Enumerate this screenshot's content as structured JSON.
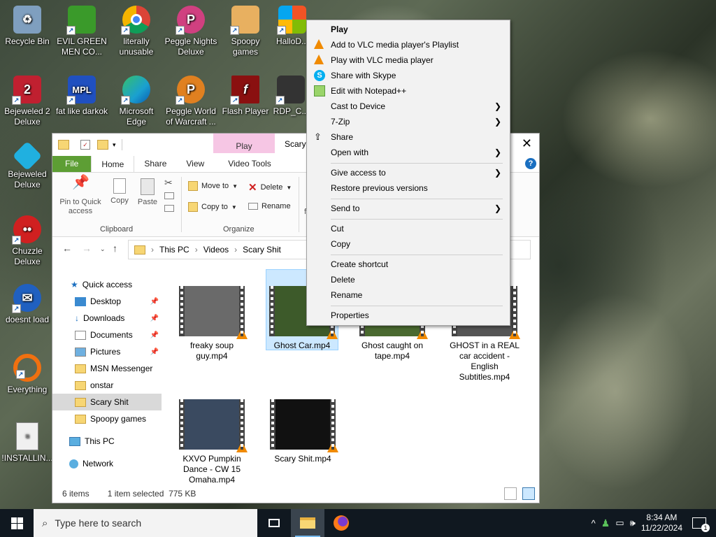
{
  "desktop": {
    "icons": [
      {
        "label": "Recycle Bin",
        "icon": "recycle-bin-icon",
        "color": "#6f8fb0"
      },
      {
        "label": "EVIL GREEN MEN CO...",
        "icon": "green-men-icon",
        "color": "#3a9a2a"
      },
      {
        "label": "literally unusable",
        "icon": "chrome-icon",
        "color": "#e0b020"
      },
      {
        "label": "Peggle Nights Deluxe",
        "icon": "peggle-nights-icon",
        "color": "#d04080"
      },
      {
        "label": "Spoopy games",
        "icon": "folder-icon",
        "color": "#e8b060"
      },
      {
        "label": "HalloD...",
        "icon": "windows-icon",
        "color": "#2a8ae0"
      },
      {
        "label": "Bejeweled 2 Deluxe",
        "icon": "bejeweled2-icon",
        "color": "#c02030"
      },
      {
        "label": "fat like darkok",
        "icon": "mpl-icon",
        "color": "#2050c0"
      },
      {
        "label": "Microsoft Edge",
        "icon": "edge-icon",
        "color": "#1aa0d0"
      },
      {
        "label": "Peggle World of Warcraft ...",
        "icon": "peggle-wow-icon",
        "color": "#e08020"
      },
      {
        "label": "Flash Player",
        "icon": "flash-icon",
        "color": "#8a1010"
      },
      {
        "label": "RDP_C...",
        "icon": "rdp-icon",
        "color": "#333333"
      },
      {
        "label": "Bejeweled Deluxe",
        "icon": "bejeweled-icon",
        "color": "#20b0e0"
      },
      {
        "label": "Chuzzle Deluxe",
        "icon": "chuzzle-icon",
        "color": "#d02020"
      },
      {
        "label": "doesnt load",
        "icon": "thunderbird-icon",
        "color": "#2060c0"
      },
      {
        "label": "Everything",
        "icon": "everything-icon",
        "color": "#f07010"
      },
      {
        "label": "!INSTALLIN...",
        "icon": "text-file-icon",
        "color": "#f0f0f0"
      }
    ]
  },
  "explorer": {
    "title": "Scary",
    "contextual_tab": "Play",
    "ribbon_tabs": [
      "File",
      "Home",
      "Share",
      "View",
      "Video Tools"
    ],
    "ribbon": {
      "pin_label": "Pin to Quick access",
      "copy_label": "Copy",
      "paste_label": "Paste",
      "clipboard_group": "Clipboard",
      "move_to": "Move to",
      "copy_to": "Copy to",
      "delete": "Delete",
      "rename": "Rename",
      "organize_group": "Organize",
      "new_partial": "f"
    },
    "address": {
      "crumbs": [
        "This PC",
        "Videos",
        "Scary Shit"
      ]
    },
    "nav": {
      "quick_access": "Quick access",
      "items": [
        "Desktop",
        "Downloads",
        "Documents",
        "Pictures",
        "MSN Messenger",
        "onstar",
        "Scary Shit",
        "Spoopy games"
      ],
      "this_pc": "This PC",
      "network": "Network"
    },
    "files": [
      {
        "name": "freaky soup guy.mp4",
        "thumb": "#6a6a6a"
      },
      {
        "name": "Ghost Car.mp4",
        "thumb": "#3d5a2a"
      },
      {
        "name": "Ghost caught on tape.mp4",
        "thumb": "#4a6a30"
      },
      {
        "name": "GHOST in a REAL car accident - English Subtitles.mp4",
        "thumb": "#555555"
      },
      {
        "name": "KXVO Pumpkin Dance - CW 15 Omaha.mp4",
        "thumb": "#3a4a60"
      },
      {
        "name": "Scary Shit.mp4",
        "thumb": "#111111"
      }
    ],
    "status": {
      "items": "6 items",
      "selection": "1 item selected  775 KB"
    }
  },
  "context_menu": {
    "items": [
      "Play",
      "Add to VLC media player's Playlist",
      "Play with VLC media player",
      "Share with Skype",
      "Edit with Notepad++",
      "Cast to Device",
      "7-Zip",
      "Share",
      "Open with",
      "Give access to",
      "Restore previous versions",
      "Send to",
      "Cut",
      "Copy",
      "Create shortcut",
      "Delete",
      "Rename",
      "Properties"
    ]
  },
  "taskbar": {
    "search_placeholder": "Type here to search",
    "time": "8:34 AM",
    "date": "11/22/2024",
    "notification_count": "1"
  }
}
